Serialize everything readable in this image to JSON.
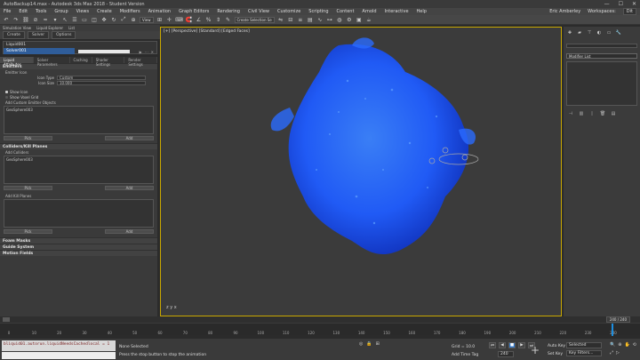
{
  "window": {
    "title": "AutoBackup14.max - Autodesk 3ds Max 2018 - Student Version",
    "controls": [
      "—",
      "☐",
      "✕"
    ]
  },
  "menu": {
    "items": [
      "File",
      "Edit",
      "Tools",
      "Group",
      "Views",
      "Create",
      "Modifiers",
      "Animation",
      "Graph Editors",
      "Rendering",
      "Civil View",
      "Customize",
      "Scripting",
      "Content",
      "Arnold",
      "Interactive",
      "Help"
    ],
    "user": "Eric Amberley",
    "workspaces_label": "Workspaces:",
    "workspace_value": "Dit"
  },
  "toolbar": {
    "view_dropdown": "View",
    "selection_set": "Create Selection Se"
  },
  "sim_view": {
    "tabs": [
      "Simulation View",
      "Liquid Explorer",
      "List"
    ],
    "panel_tabs": [
      "Create",
      "Solver",
      "Options"
    ],
    "items": [
      "Liquid001",
      "Solver001"
    ]
  },
  "left_panel": {
    "tabs": [
      "Liquid Attributes",
      "Solver Parameters",
      "Caching",
      "Shader Settings",
      "Render Settings"
    ],
    "emitters_header": "Emitters",
    "emitter_icon_label": "Emitter Icon",
    "icon_type_label": "Icon Type",
    "icon_type_value": "Custom",
    "icon_size_label": "Icon Size",
    "icon_size_value": "10.000",
    "show_icon": "Show Icon",
    "show_voxel_grid": "Show Voxel Grid",
    "custom_emitter_label": "Add Custom Emitter Objects",
    "custom_emitter_items": [
      "GeoSphere003"
    ],
    "pick": "Pick",
    "add": "Add",
    "colliders_header": "Colliders/Kill Planes",
    "add_colliders": "Add Colliders",
    "collider_items": [
      "GeoSphere003"
    ],
    "add_kill_planes": "Add Kill Planes",
    "kill_plane_items": [],
    "foam_masks": "Foam Masks",
    "guide_system": "Guide System",
    "motion_fields": "Motion Fields"
  },
  "viewport": {
    "label": "[+] [Perspective] [Standard] [Edged Faces]",
    "axis": "z y x",
    "fluid_color": "#1f5cff",
    "fluid_color_dark": "#0d2fbf",
    "fluid_color_light": "#3a82ff"
  },
  "right_panel": {
    "modifier_list": "Modifier List"
  },
  "timeline": {
    "frame_readout": "240 / 240",
    "ticks": [
      "0",
      "10",
      "20",
      "30",
      "40",
      "50",
      "60",
      "70",
      "80",
      "90",
      "100",
      "110",
      "120",
      "130",
      "140",
      "150",
      "160",
      "170",
      "180",
      "190",
      "200",
      "210",
      "220",
      "230",
      "240"
    ],
    "current_frame_fraction": 1.0
  },
  "status": {
    "maxscript": "bliquid01.autorun.liquidNeedsCachedlocal = 1",
    "selection": "None Selected",
    "prompt": "Press the stop button to stop the animation",
    "grid": "Grid = 10.0",
    "add_time_tag": "Add Time Tag",
    "frame_value": "240",
    "auto_key": "Auto Key",
    "set_key": "Set Key",
    "selected": "Selected",
    "key_filters": "Key Filters..."
  }
}
